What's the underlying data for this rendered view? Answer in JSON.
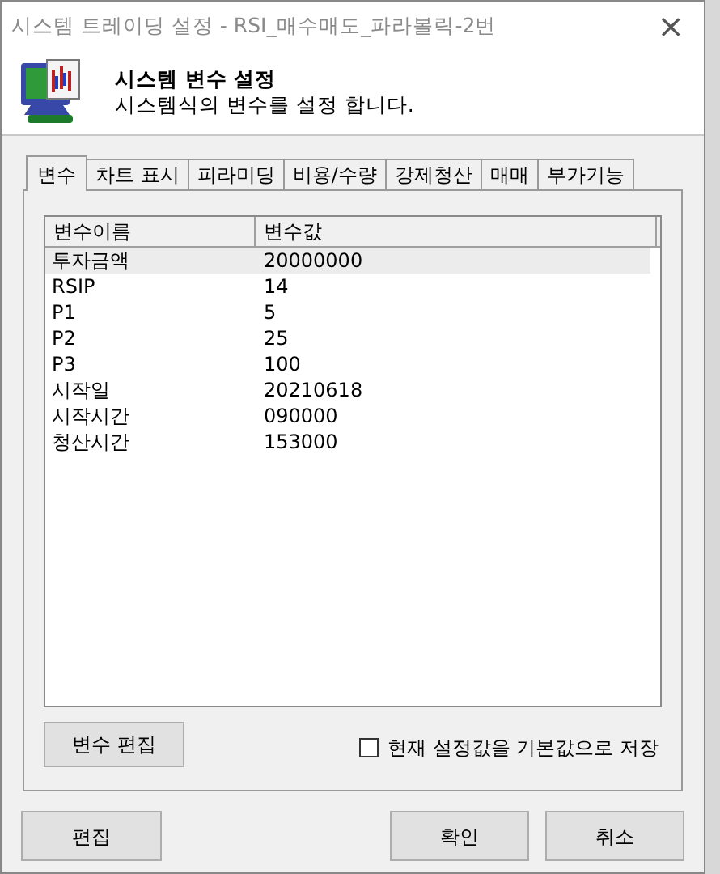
{
  "window": {
    "title": "시스템 트레이딩 설정 - RSI_매수매도_파라볼릭-2번",
    "close": "×"
  },
  "header": {
    "title": "시스템 변수 설정",
    "subtitle": "시스템식의 변수를 설정 합니다."
  },
  "tabs": [
    {
      "label": "변수",
      "selected": true
    },
    {
      "label": "차트 표시",
      "selected": false
    },
    {
      "label": "피라미딩",
      "selected": false
    },
    {
      "label": "비용/수량",
      "selected": false
    },
    {
      "label": "강제청산",
      "selected": false
    },
    {
      "label": "매매",
      "selected": false
    },
    {
      "label": "부가기능",
      "selected": false
    }
  ],
  "table": {
    "columns": [
      "변수이름",
      "변수값"
    ],
    "rows": [
      {
        "cells": [
          "투자금액",
          "20000000"
        ],
        "selected": true
      },
      {
        "cells": [
          "RSIP",
          "14"
        ],
        "selected": false
      },
      {
        "cells": [
          "P1",
          "5"
        ],
        "selected": false
      },
      {
        "cells": [
          "P2",
          "25"
        ],
        "selected": false
      },
      {
        "cells": [
          "P3",
          "100"
        ],
        "selected": false
      },
      {
        "cells": [
          "시작일",
          "20210618"
        ],
        "selected": false
      },
      {
        "cells": [
          "시작시간",
          "090000"
        ],
        "selected": false
      },
      {
        "cells": [
          "청산시간",
          "153000"
        ],
        "selected": false
      }
    ]
  },
  "edit_variables_button": "변수 편집",
  "save_default": {
    "label": "현재 설정값을 기본값으로 저장",
    "checked": false
  },
  "buttons": {
    "edit": "편집",
    "ok": "확인",
    "cancel": "취소"
  }
}
